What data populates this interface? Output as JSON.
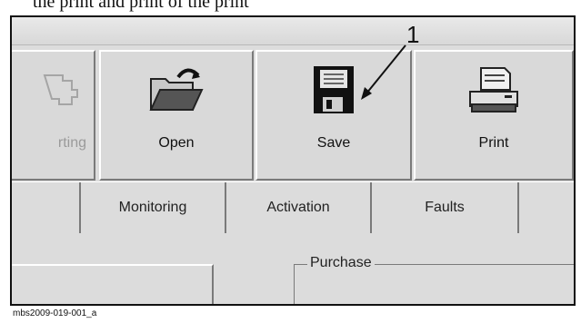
{
  "top_caption": "the print and print of the print",
  "toolbar": {
    "buttons": [
      {
        "label": "rting",
        "state": "disabled",
        "icon": "setting-icon"
      },
      {
        "label": "Open",
        "state": "enabled",
        "icon": "folder-open-icon"
      },
      {
        "label": "Save",
        "state": "enabled",
        "icon": "floppy-disk-icon"
      },
      {
        "label": "Print",
        "state": "enabled",
        "icon": "printer-icon"
      }
    ]
  },
  "tabs": [
    {
      "label": ""
    },
    {
      "label": "Monitoring"
    },
    {
      "label": "Activation"
    },
    {
      "label": "Faults"
    }
  ],
  "panel": {
    "group_label": "Purchase"
  },
  "callout": {
    "number": "1"
  },
  "figure_ref": "mbs2009-019-001_a"
}
